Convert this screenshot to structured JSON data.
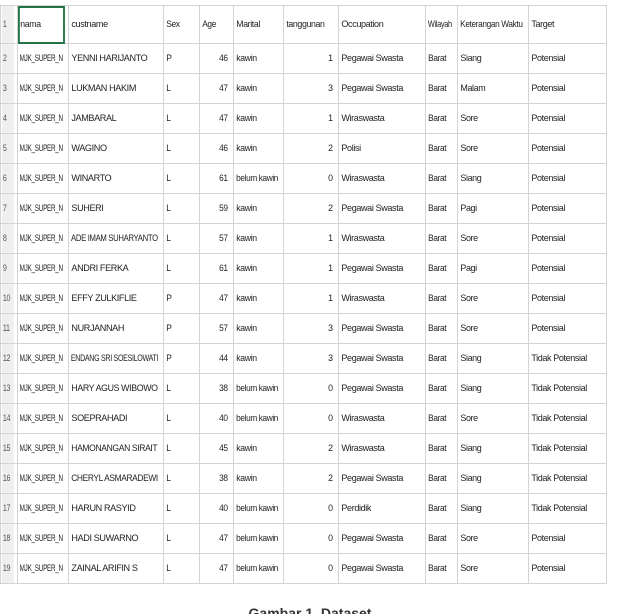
{
  "sheet": {
    "headers": [
      "nama",
      "custname",
      "Sex",
      "Age",
      "Marital",
      "tanggunan",
      "Occupation",
      "Wilayah",
      "Keterangan Waktu",
      "Target"
    ],
    "rows": [
      [
        "MJK_SUPER_N",
        "YENNI HARIJANTO",
        "P",
        "46",
        "kawin",
        "1",
        "Pegawai Swasta",
        "Barat",
        "Siang",
        "Potensial"
      ],
      [
        "MJK_SUPER_N",
        "LUKMAN HAKIM",
        "L",
        "47",
        "kawin",
        "3",
        "Pegawai Swasta",
        "Barat",
        "Malam",
        "Potensial"
      ],
      [
        "MJK_SUPER_N",
        "JAMBARAL",
        "L",
        "47",
        "kawin",
        "1",
        "Wiraswasta",
        "Barat",
        "Sore",
        "Potensial"
      ],
      [
        "MJK_SUPER_N",
        "WAGINO",
        "L",
        "46",
        "kawin",
        "2",
        "Polisi",
        "Barat",
        "Sore",
        "Potensial"
      ],
      [
        "MJK_SUPER_N",
        "WINARTO",
        "L",
        "61",
        "belum kawin",
        "0",
        "Wiraswasta",
        "Barat",
        "Siang",
        "Potensial"
      ],
      [
        "MJK_SUPER_N",
        "SUHERI",
        "L",
        "59",
        "kawin",
        "2",
        "Pegawai Swasta",
        "Barat",
        "Pagi",
        "Potensial"
      ],
      [
        "MJK_SUPER_N",
        "ADE IMAM SUHARYANTO",
        "L",
        "57",
        "kawin",
        "1",
        "Wiraswasta",
        "Barat",
        "Sore",
        "Potensial"
      ],
      [
        "MJK_SUPER_N",
        "ANDRI FERKA",
        "L",
        "61",
        "kawin",
        "1",
        "Pegawai Swasta",
        "Barat",
        "Pagi",
        "Potensial"
      ],
      [
        "MJK_SUPER_N",
        "EFFY ZULKIFLIE",
        "P",
        "47",
        "kawin",
        "1",
        "Wiraswasta",
        "Barat",
        "Sore",
        "Potensial"
      ],
      [
        "MJK_SUPER_N",
        "NURJANNAH",
        "P",
        "57",
        "kawin",
        "3",
        "Pegawai Swasta",
        "Barat",
        "Sore",
        "Potensial"
      ],
      [
        "MJK_SUPER_N",
        "ENDANG SRI SOESILOWATI",
        "P",
        "44",
        "kawin",
        "3",
        "Pegawai Swasta",
        "Barat",
        "Siang",
        "Tidak Potensial"
      ],
      [
        "MJK_SUPER_N",
        "HARY AGUS WIBOWO",
        "L",
        "38",
        "belum kawin",
        "0",
        "Pegawai Swasta",
        "Barat",
        "Siang",
        "Tidak Potensial"
      ],
      [
        "MJK_SUPER_N",
        "SOEPRAHADI",
        "L",
        "40",
        "belum kawin",
        "0",
        "Wiraswasta",
        "Barat",
        "Sore",
        "Tidak Potensial"
      ],
      [
        "MJK_SUPER_N",
        "HAMONANGAN SIRAIT",
        "L",
        "45",
        "kawin",
        "2",
        "Wiraswasta",
        "Barat",
        "Siang",
        "Tidak Potensial"
      ],
      [
        "MJK_SUPER_N",
        "CHERYL ASMARADEWI",
        "L",
        "38",
        "kawin",
        "2",
        "Pegawai Swasta",
        "Barat",
        "Siang",
        "Tidak Potensial"
      ],
      [
        "MJK_SUPER_N",
        "HARUN RASYID",
        "L",
        "40",
        "belum kawin",
        "0",
        "Perdidik",
        "Barat",
        "Siang",
        "Tidak Potensial"
      ],
      [
        "MJK_SUPER_N",
        "HADI SUWARNO",
        "L",
        "47",
        "belum kawin",
        "0",
        "Pegawai Swasta",
        "Barat",
        "Sore",
        "Potensial"
      ],
      [
        "MJK_SUPER_N",
        "ZAINAL ARIFIN S",
        "L",
        "47",
        "belum kawin",
        "0",
        "Pegawai Swasta",
        "Barat",
        "Sore",
        "Potensial"
      ]
    ],
    "numeric_columns": [
      3,
      5
    ],
    "selected_cell": [
      0,
      0
    ],
    "colors": {
      "grid": "#d4d4d4",
      "row_number_bg": "#efefef",
      "selection": "#217346"
    }
  },
  "caption": "Gambar 1. Dataset"
}
